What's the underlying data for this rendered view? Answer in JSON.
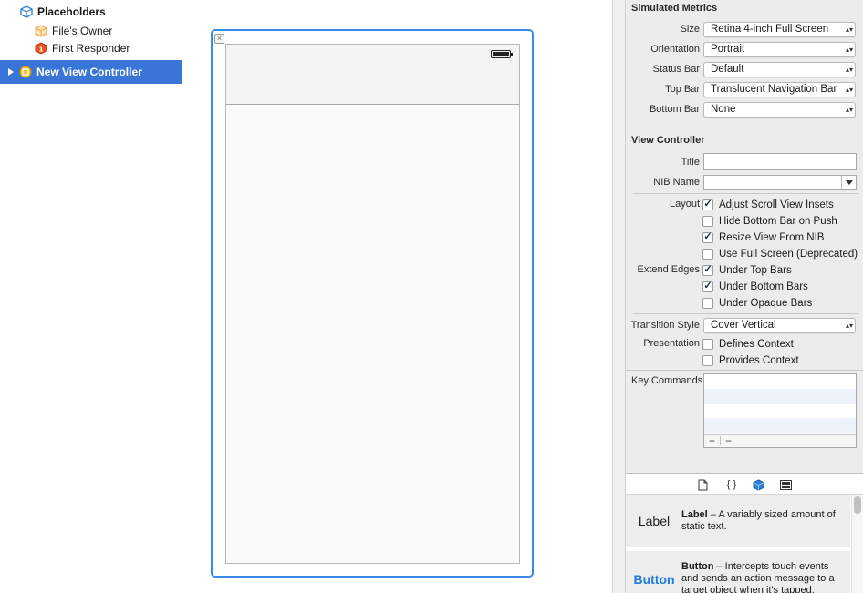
{
  "outline": {
    "placeholders_label": "Placeholders",
    "files_owner": "File's Owner",
    "first_responder": "First Responder",
    "selected_item": "New View Controller"
  },
  "inspector": {
    "simulated_metrics": {
      "title": "Simulated Metrics",
      "size_label": "Size",
      "size_value": "Retina 4-inch Full Screen",
      "orientation_label": "Orientation",
      "orientation_value": "Portrait",
      "status_bar_label": "Status Bar",
      "status_bar_value": "Default",
      "top_bar_label": "Top Bar",
      "top_bar_value": "Translucent Navigation Bar",
      "bottom_bar_label": "Bottom Bar",
      "bottom_bar_value": "None"
    },
    "view_controller": {
      "title": "View Controller",
      "title_label": "Title",
      "title_value": "",
      "nib_name_label": "NIB Name",
      "nib_name_value": "",
      "layout_label": "Layout",
      "adjust_scroll": "Adjust Scroll View Insets",
      "hide_bottom_bar": "Hide Bottom Bar on Push",
      "resize_view": "Resize View From NIB",
      "use_full_screen": "Use Full Screen (Deprecated)",
      "extend_edges_label": "Extend Edges",
      "under_top_bars": "Under Top Bars",
      "under_bottom_bars": "Under Bottom Bars",
      "under_opaque_bars": "Under Opaque Bars",
      "transition_style_label": "Transition Style",
      "transition_style_value": "Cover Vertical",
      "presentation_label": "Presentation",
      "defines_context": "Defines Context",
      "provides_context": "Provides Context",
      "key_commands_label": "Key Commands",
      "add_symbol": "+",
      "remove_symbol": "−"
    },
    "checkbox_states": {
      "adjust_scroll": true,
      "hide_bottom_bar": false,
      "resize_view": true,
      "use_full_screen": false,
      "under_top_bars": true,
      "under_bottom_bars": true,
      "under_opaque_bars": false,
      "defines_context": false,
      "provides_context": false
    }
  },
  "library": {
    "tab_icons": [
      "file-template-icon",
      "code-snippet-icon",
      "object-library-icon",
      "media-library-icon"
    ],
    "code_tab_glyph": "{ }",
    "label_item": {
      "thumb": "Label",
      "name": "Label",
      "desc": " – A variably sized amount of static text."
    },
    "button_item": {
      "thumb": "Button",
      "name": "Button",
      "desc": " – Intercepts touch events and sends an action message to a target object when it's tapped."
    }
  },
  "colors": {
    "selection": "#3875d7",
    "scene_border": "#3a8be6",
    "button_blue": "#1a7bd9",
    "checkbox_check": "#1b2a40"
  }
}
